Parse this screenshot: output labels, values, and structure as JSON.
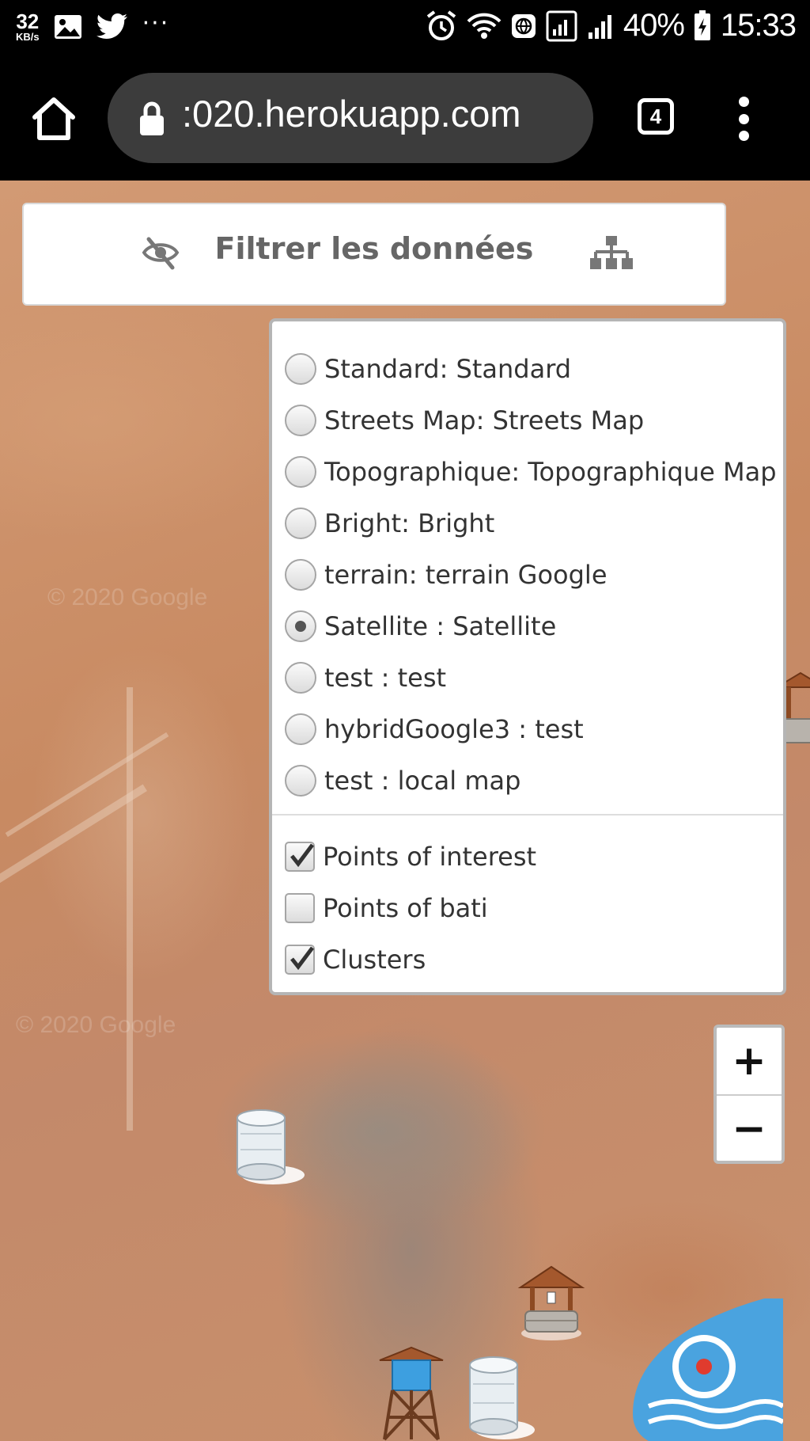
{
  "status_bar": {
    "net_speed": "32",
    "net_unit": "KB/s",
    "more_notifications": "···",
    "battery": "40%",
    "time": "15:33"
  },
  "browser": {
    "url": ":020.herokuapp.com",
    "tab_count": "4"
  },
  "filter_bar": {
    "title": "Filtrer les données"
  },
  "layers": {
    "base_layers": [
      {
        "label": "Standard: Standard",
        "selected": false
      },
      {
        "label": "Streets Map: Streets Map",
        "selected": false
      },
      {
        "label": "Topographique: Topographique Map",
        "selected": false
      },
      {
        "label": "Bright: Bright",
        "selected": false
      },
      {
        "label": "terrain: terrain Google",
        "selected": false
      },
      {
        "label": "Satellite : Satellite",
        "selected": true
      },
      {
        "label": "test : test",
        "selected": false
      },
      {
        "label": "hybridGoogle3 : test",
        "selected": false
      },
      {
        "label": "test : local map",
        "selected": false
      }
    ],
    "overlays": [
      {
        "label": "Points of interest",
        "checked": true
      },
      {
        "label": "Points of bati",
        "checked": false
      },
      {
        "label": "Clusters",
        "checked": true
      }
    ]
  },
  "zoom": {
    "in_label": "+",
    "out_label": "−"
  },
  "map": {
    "watermark": "© 2020 Google"
  },
  "colors": {
    "status_bar": "#000000",
    "url_pill": "#3c3c3c",
    "map_terrain": "#c98b63",
    "filter_title": "#666666",
    "logo_drop": "#4aa3df"
  },
  "icons": {
    "home": "home-icon",
    "lock": "lock-icon",
    "eye_slash": "eye-slash-icon",
    "sitemap": "sitemap-icon",
    "water_tank": "water-tank-icon",
    "well": "well-icon",
    "water_tower": "water-tower-icon"
  }
}
